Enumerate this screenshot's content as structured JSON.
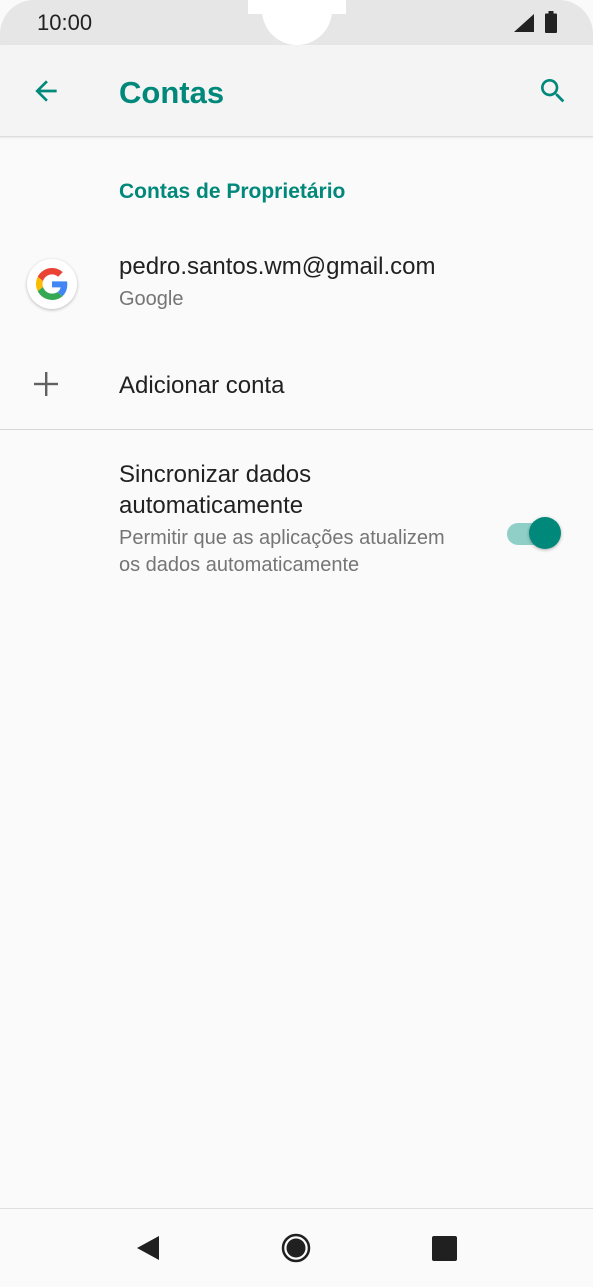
{
  "status_bar": {
    "time": "10:00"
  },
  "app_bar": {
    "title": "Contas",
    "back_icon": "arrow-back-icon",
    "search_icon": "search-icon"
  },
  "accounts": {
    "section_header": "Contas de Proprietário",
    "items": [
      {
        "email": "pedro.santos.wm@gmail.com",
        "type": "Google",
        "icon": "google-icon"
      }
    ],
    "add_label": "Adicionar conta"
  },
  "sync": {
    "title": "Sincronizar dados automaticamente",
    "summary": "Permitir que as aplicações atualizem os dados automaticamente",
    "enabled": true
  },
  "colors": {
    "accent": "#00897b",
    "toggle_track": "#8fcfc7",
    "background": "#fafafa"
  },
  "nav_bar": {
    "back_icon": "nav-back-icon",
    "home_icon": "nav-home-icon",
    "recents_icon": "nav-recents-icon"
  }
}
